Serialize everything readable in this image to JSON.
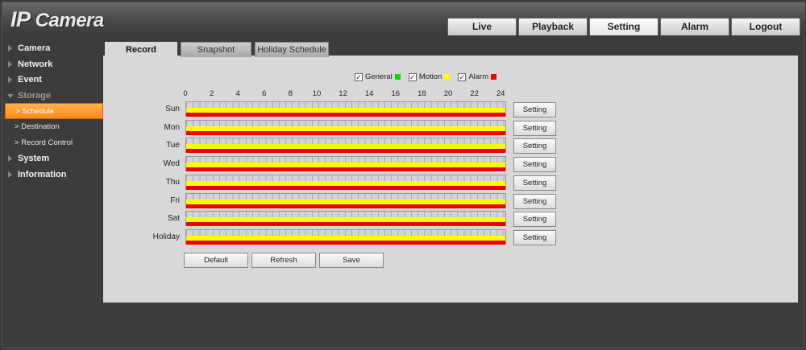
{
  "app": {
    "title_ip": "IP",
    "title_rest": " Camera"
  },
  "topnav": [
    "Live",
    "Playback",
    "Setting",
    "Alarm",
    "Logout"
  ],
  "topnav_active": "Setting",
  "sidebar": {
    "items": [
      {
        "label": "Camera"
      },
      {
        "label": "Network"
      },
      {
        "label": "Event"
      },
      {
        "label": "Storage"
      },
      {
        "label": "Schedule"
      },
      {
        "label": "Destination"
      },
      {
        "label": "Record Control"
      },
      {
        "label": "System"
      },
      {
        "label": "Information"
      }
    ],
    "sub_prefix": ">"
  },
  "subtabs": [
    "Record",
    "Snapshot",
    "Holiday Schedule"
  ],
  "legend": [
    {
      "label": "General",
      "color": "#00dd00",
      "checked": "✓"
    },
    {
      "label": "Motion",
      "color": "#ffff00",
      "checked": "✓"
    },
    {
      "label": "Alarm",
      "color": "#ee0000",
      "checked": "✓"
    }
  ],
  "hours": [
    "0",
    "2",
    "4",
    "6",
    "8",
    "10",
    "12",
    "14",
    "16",
    "18",
    "20",
    "22",
    "24"
  ],
  "days": [
    "Sun",
    "Mon",
    "Tue",
    "Wed",
    "Thu",
    "Fri",
    "Sat",
    "Holiday"
  ],
  "setting_label": "Setting",
  "buttons": {
    "default": "Default",
    "refresh": "Refresh",
    "save": "Save"
  }
}
